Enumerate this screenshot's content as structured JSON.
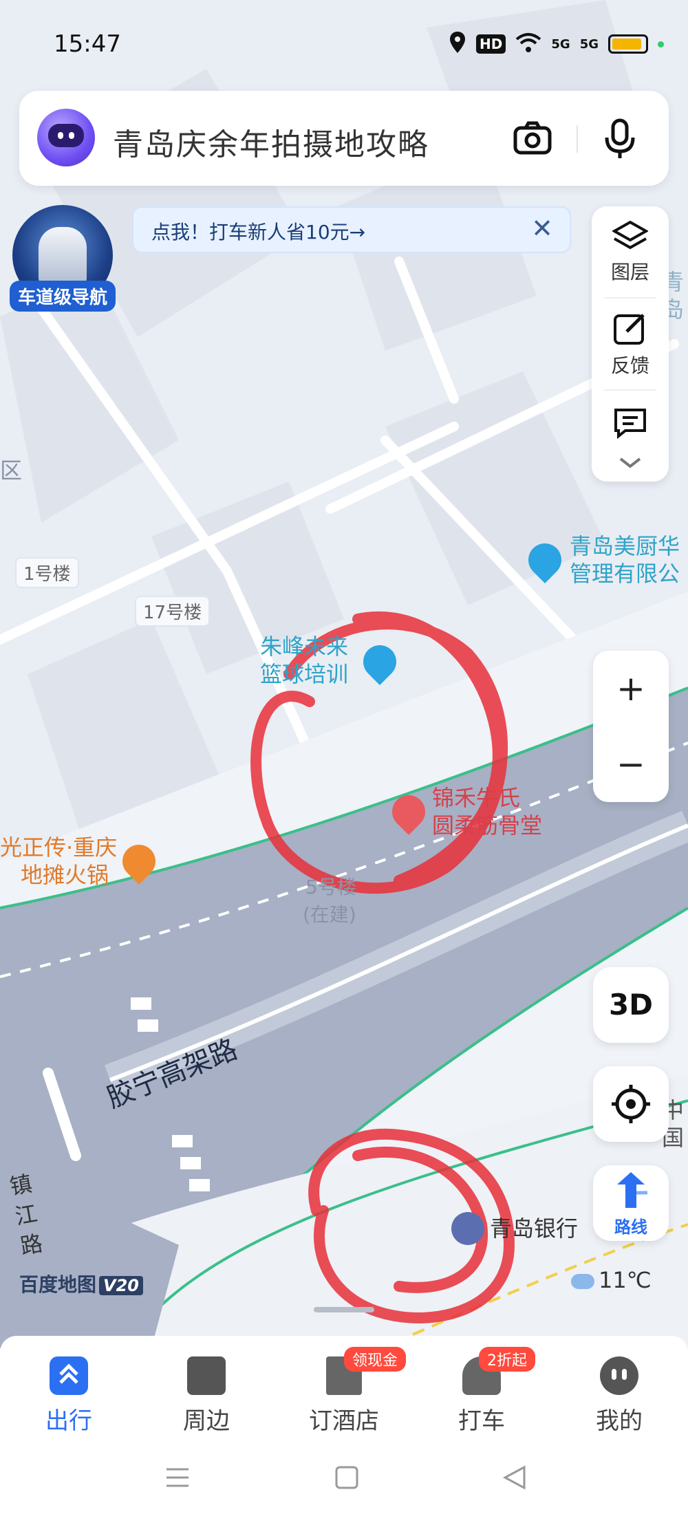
{
  "status_bar": {
    "time": "15:47",
    "hd_label": "HD",
    "signal1": "5G",
    "signal2": "5G"
  },
  "search": {
    "query": "青岛庆余年拍摄地攻略"
  },
  "lane_nav": {
    "label": "车道级导航"
  },
  "promo": {
    "text": "点我！打车新人省10元→",
    "close": "✕"
  },
  "tools": {
    "layers_label": "图层",
    "feedback_label": "反馈"
  },
  "zoom": {
    "in": "+",
    "out": "−"
  },
  "three_d": "3D",
  "route_label": "路线",
  "map": {
    "building_1": "1号楼",
    "building_17": "17号楼",
    "poi_basketball_1": "朱峰未来",
    "poi_basketball_2": "篮球培训",
    "poi_clinic_1": "锦禾牛氏",
    "poi_clinic_2": "圆柔筋骨堂",
    "poi_company_1": "青岛美厨华",
    "poi_company_2": "管理有限公",
    "poi_hotpot_1": "光正传·重庆",
    "poi_hotpot_2": "地摊火锅",
    "building_5_1": "5号楼",
    "building_5_2": "(在建)",
    "road_elevated": "胶宁高架路",
    "road_zhenjiang": "镇江路",
    "poi_bank": "青岛银行",
    "edge_right_1": "青岛",
    "edge_right_2": "中国",
    "edge_left": "区"
  },
  "brand": {
    "name": "百度地图",
    "version": "V20"
  },
  "weather": {
    "temp": "11℃"
  },
  "bottom_nav": {
    "items": [
      {
        "label": "出行"
      },
      {
        "label": "周边"
      },
      {
        "label": "订酒店",
        "badge": "领现金"
      },
      {
        "label": "打车",
        "badge": "2折起"
      },
      {
        "label": "我的"
      }
    ]
  },
  "colors": {
    "accent": "#2b6ff2",
    "road_outline": "#3bbf8a",
    "annotation": "#e8303a"
  }
}
